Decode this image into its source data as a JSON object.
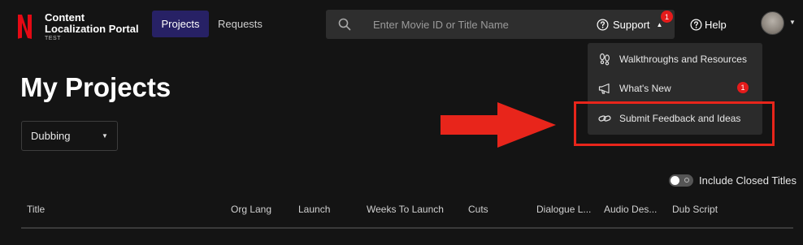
{
  "header": {
    "brand_line1": "Content",
    "brand_line2": "Localization Portal",
    "brand_env": "TEST",
    "nav": {
      "projects": "Projects",
      "requests": "Requests"
    },
    "search": {
      "placeholder": "Enter Movie ID or Title Name",
      "value": ""
    },
    "support": {
      "label": "Support",
      "badge": "1"
    },
    "help": {
      "label": "Help"
    }
  },
  "support_menu": {
    "items": [
      {
        "label": "Walkthroughs and Resources",
        "icon": "footprints-icon"
      },
      {
        "label": "What's New",
        "icon": "megaphone-icon",
        "badge": "1"
      },
      {
        "label": "Submit Feedback and Ideas",
        "icon": "link-icon"
      }
    ]
  },
  "page": {
    "title": "My Projects",
    "filter": {
      "selected": "Dubbing"
    },
    "toggle": {
      "label": "Include Closed Titles",
      "on": false
    }
  },
  "table": {
    "columns": [
      "Title",
      "Org Lang",
      "Launch",
      "Weeks To Launch",
      "Cuts",
      "Dialogue L...",
      "Audio Des...",
      "Dub Script"
    ]
  },
  "colors": {
    "background": "#141414",
    "accent_nav": "#272165",
    "badge_red": "#e51b1b",
    "annotation_red": "#e8251b"
  }
}
